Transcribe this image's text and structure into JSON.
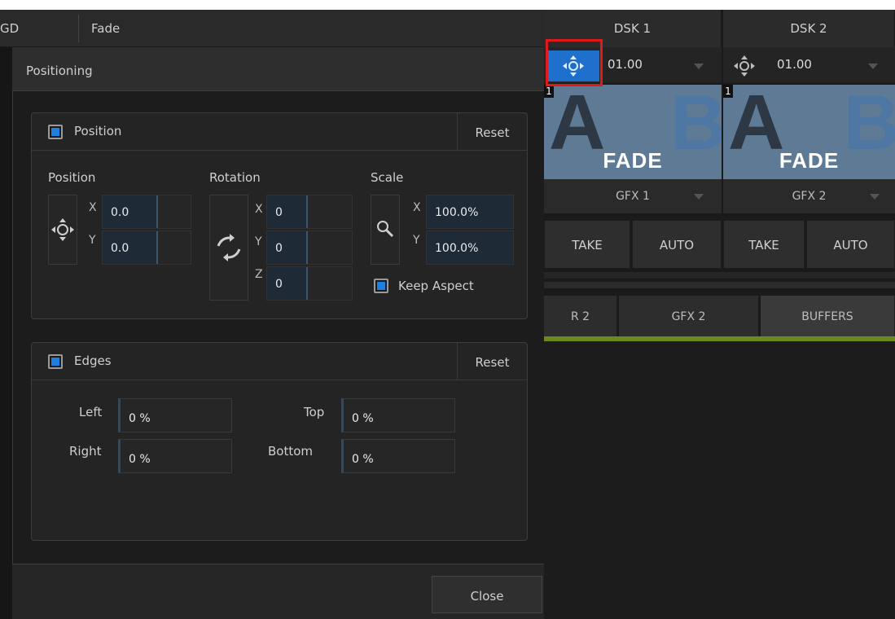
{
  "topbar": {
    "left_label": "GD",
    "transition_label": "Fade"
  },
  "dialog": {
    "title": "Positioning",
    "position_group": {
      "title": "Position",
      "reset_label": "Reset",
      "position": {
        "label": "Position",
        "x_axis": "X",
        "y_axis": "Y",
        "x": "0.0",
        "y": "0.0"
      },
      "rotation": {
        "label": "Rotation",
        "x_axis": "X",
        "y_axis": "Y",
        "z_axis": "Z",
        "x": "0",
        "y": "0",
        "z": "0"
      },
      "scale": {
        "label": "Scale",
        "x_axis": "X",
        "y_axis": "Y",
        "x": "100.0%",
        "y": "100.0%"
      },
      "keep_aspect_label": "Keep Aspect"
    },
    "edges_group": {
      "title": "Edges",
      "reset_label": "Reset",
      "left_label": "Left",
      "left_value": "0 %",
      "right_label": "Right",
      "right_value": "0 %",
      "top_label": "Top",
      "top_value": "0 %",
      "bottom_label": "Bottom",
      "bottom_value": "0 %"
    },
    "close_label": "Close"
  },
  "dsk": [
    {
      "title": "DSK 1",
      "duration": "01.00",
      "thumb_number": "1",
      "thumb_a": "A",
      "thumb_b": "B",
      "thumb_label": "FADE",
      "source": "GFX 1",
      "take_label": "TAKE",
      "auto_label": "AUTO"
    },
    {
      "title": "DSK 2",
      "duration": "01.00",
      "thumb_number": "1",
      "thumb_a": "A",
      "thumb_b": "B",
      "thumb_label": "FADE",
      "source": "GFX 2",
      "take_label": "TAKE",
      "auto_label": "AUTO"
    }
  ],
  "tabs": [
    "R 2",
    "GFX 2",
    "BUFFERS"
  ],
  "colors": {
    "accent": "#1f7fe0",
    "highlight": "#e01a1a",
    "program_line": "#6b8a1e"
  }
}
